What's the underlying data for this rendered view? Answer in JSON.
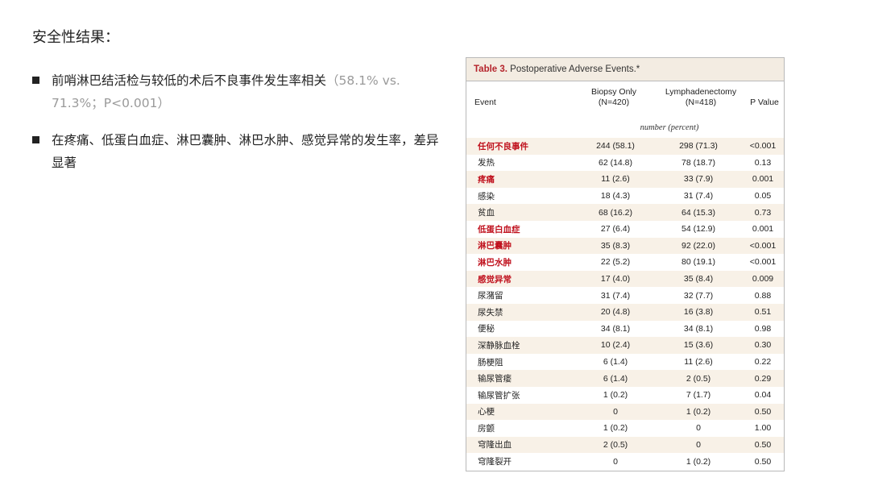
{
  "page_title": "安全性结果：",
  "bullets": [
    {
      "text": "前哨淋巴结活检与较低的术后不良事件发生率相关",
      "note": "（58.1% vs. 71.3%；P<0.001）"
    },
    {
      "text": "在疼痛、低蛋白血症、淋巴囊肿、淋巴水肿、感觉异常的发生率，差异显著",
      "note": ""
    }
  ],
  "table": {
    "title_num": "Table 3.",
    "title_text": " Postoperative Adverse Events.*",
    "headers": {
      "event": "Event",
      "biopsy_line1": "Biopsy Only",
      "biopsy_line2": "(N=420)",
      "lymph_line1": "Lymphadenectomy",
      "lymph_line2": "(N=418)",
      "p": "P Value"
    },
    "unit": "number (percent)",
    "highlight_color": "#c0121e",
    "rows": [
      {
        "event": "任何不良事件",
        "biopsy": "244 (58.1)",
        "lymph": "298 (71.3)",
        "p": "<0.001",
        "hl": true
      },
      {
        "event": "发热",
        "biopsy": "62 (14.8)",
        "lymph": "78 (18.7)",
        "p": "0.13",
        "hl": false
      },
      {
        "event": "疼痛",
        "biopsy": "11 (2.6)",
        "lymph": "33 (7.9)",
        "p": "0.001",
        "hl": true
      },
      {
        "event": "感染",
        "biopsy": "18 (4.3)",
        "lymph": "31 (7.4)",
        "p": "0.05",
        "hl": false
      },
      {
        "event": "贫血",
        "biopsy": "68 (16.2)",
        "lymph": "64 (15.3)",
        "p": "0.73",
        "hl": false
      },
      {
        "event": "低蛋白血症",
        "biopsy": "27 (6.4)",
        "lymph": "54 (12.9)",
        "p": "0.001",
        "hl": true
      },
      {
        "event": "淋巴囊肿",
        "biopsy": "35 (8.3)",
        "lymph": "92 (22.0)",
        "p": "<0.001",
        "hl": true
      },
      {
        "event": "淋巴水肿",
        "biopsy": "22 (5.2)",
        "lymph": "80 (19.1)",
        "p": "<0.001",
        "hl": true
      },
      {
        "event": "感觉异常",
        "biopsy": "17 (4.0)",
        "lymph": "35 (8.4)",
        "p": "0.009",
        "hl": true
      },
      {
        "event": "尿潴留",
        "biopsy": "31 (7.4)",
        "lymph": "32 (7.7)",
        "p": "0.88",
        "hl": false
      },
      {
        "event": "尿失禁",
        "biopsy": "20 (4.8)",
        "lymph": "16 (3.8)",
        "p": "0.51",
        "hl": false
      },
      {
        "event": "便秘",
        "biopsy": "34 (8.1)",
        "lymph": "34 (8.1)",
        "p": "0.98",
        "hl": false
      },
      {
        "event": "深静脉血栓",
        "biopsy": "10 (2.4)",
        "lymph": "15 (3.6)",
        "p": "0.30",
        "hl": false
      },
      {
        "event": "肠梗阻",
        "biopsy": "6 (1.4)",
        "lymph": "11 (2.6)",
        "p": "0.22",
        "hl": false
      },
      {
        "event": "输尿管瘘",
        "biopsy": "6 (1.4)",
        "lymph": "2 (0.5)",
        "p": "0.29",
        "hl": false
      },
      {
        "event": "输尿管扩张",
        "biopsy": "1 (0.2)",
        "lymph": "7 (1.7)",
        "p": "0.04",
        "hl": false
      },
      {
        "event": "心梗",
        "biopsy": "0",
        "lymph": "1 (0.2)",
        "p": "0.50",
        "hl": false
      },
      {
        "event": "房颤",
        "biopsy": "1 (0.2)",
        "lymph": "0",
        "p": "1.00",
        "hl": false
      },
      {
        "event": "穹隆出血",
        "biopsy": "2 (0.5)",
        "lymph": "0",
        "p": "0.50",
        "hl": false
      },
      {
        "event": "穹隆裂开",
        "biopsy": "0",
        "lymph": "1 (0.2)",
        "p": "0.50",
        "hl": false
      }
    ]
  }
}
